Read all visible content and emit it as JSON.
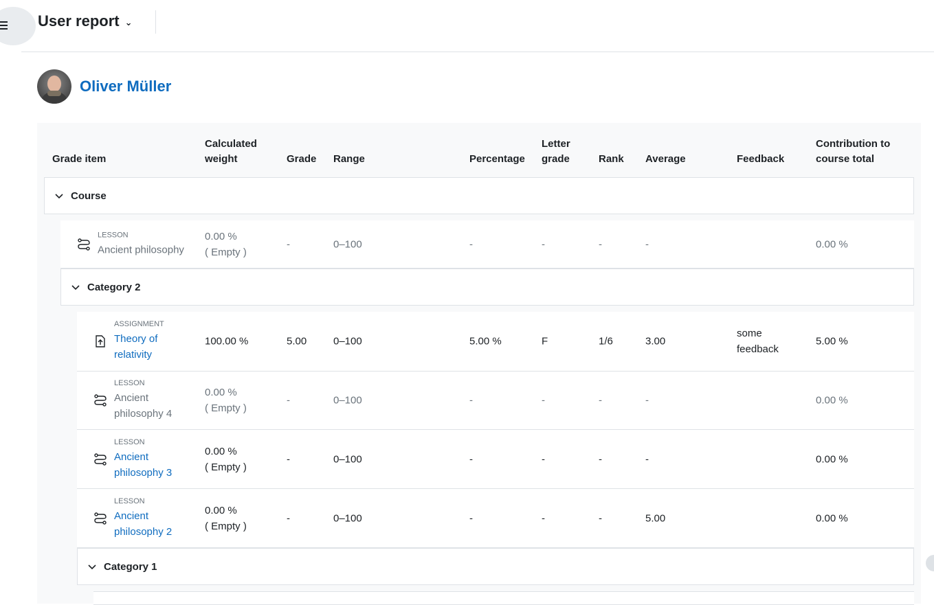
{
  "header": {
    "title": "User report"
  },
  "user": {
    "name": "Oliver Müller"
  },
  "columns": {
    "grade_item": "Grade item",
    "calc_weight_1": "Calculated",
    "calc_weight_2": "weight",
    "grade": "Grade",
    "range": "Range",
    "percentage": "Percentage",
    "letter_1": "Letter",
    "letter_2": "grade",
    "rank": "Rank",
    "average": "Average",
    "feedback": "Feedback",
    "contrib_1": "Contribution to",
    "contrib_2": "course total"
  },
  "categories": {
    "course": "Course",
    "cat2": "Category 2",
    "cat1": "Category 1"
  },
  "items": [
    {
      "type": "LESSON",
      "name": "Ancient philosophy",
      "weight": "0.00 %",
      "weight_note": "( Empty )",
      "grade": "-",
      "range": "0–100",
      "percentage": "-",
      "letter": "-",
      "rank": "-",
      "average": "-",
      "feedback": "",
      "contribution": "0.00 %"
    },
    {
      "type": "ASSIGNMENT",
      "name_1": "Theory of",
      "name_2": "relativity",
      "weight": "100.00 %",
      "grade": "5.00",
      "range": "0–100",
      "percentage": "5.00 %",
      "letter": "F",
      "rank": "1/6",
      "average": "3.00",
      "feedback_1": "some",
      "feedback_2": "feedback",
      "contribution": "5.00 %"
    },
    {
      "type": "LESSON",
      "name_1": "Ancient",
      "name_2": "philosophy 4",
      "weight": "0.00 %",
      "weight_note": "( Empty )",
      "grade": "-",
      "range": "0–100",
      "percentage": "-",
      "letter": "-",
      "rank": "-",
      "average": "-",
      "contribution": "0.00 %"
    },
    {
      "type": "LESSON",
      "name_1": "Ancient",
      "name_2": "philosophy 3",
      "weight": "0.00 %",
      "weight_note": "( Empty )",
      "grade": "-",
      "range": "0–100",
      "percentage": "-",
      "letter": "-",
      "rank": "-",
      "average": "-",
      "contribution": "0.00 %"
    },
    {
      "type": "LESSON",
      "name_1": "Ancient",
      "name_2": "philosophy 2",
      "weight": "0.00 %",
      "weight_note": "( Empty )",
      "grade": "-",
      "range": "0–100",
      "percentage": "-",
      "letter": "-",
      "rank": "-",
      "average": "5.00",
      "contribution": "0.00 %"
    }
  ],
  "icons": {
    "lesson": "lesson-icon",
    "assignment": "assignment-icon",
    "chevron": "chevron-down-icon"
  }
}
